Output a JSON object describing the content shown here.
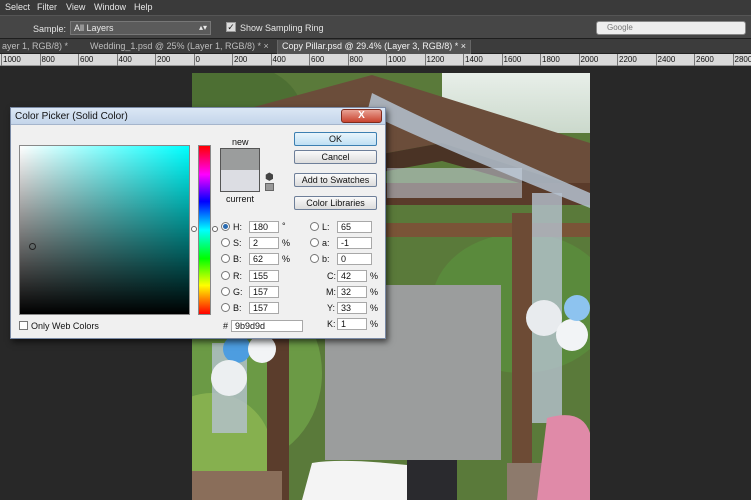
{
  "menu": [
    "Select",
    "Filter",
    "View",
    "Window",
    "Help"
  ],
  "options_bar": {
    "sample_label": "Sample:",
    "sample_value": "All Layers",
    "sampling_ring_label": "Show Sampling Ring",
    "sampling_ring_checked": "✓",
    "search_placeholder": "Google"
  },
  "tabs": [
    {
      "label": "ayer 1, RGB/8) *"
    },
    {
      "label": "Wedding_1.psd @ 25% (Layer 1, RGB/8) * ×"
    },
    {
      "label": "Copy Pillar.psd @ 29.4% (Layer 3, RGB/8) * ×"
    }
  ],
  "ruler": [
    "1000",
    "800",
    "600",
    "400",
    "200",
    "0",
    "200",
    "400",
    "600",
    "800",
    "1000",
    "1200",
    "1400",
    "1600",
    "1800",
    "2000",
    "2200",
    "2400",
    "2600",
    "2800"
  ],
  "dialog": {
    "title": "Color Picker (Solid Color)",
    "close": "X",
    "new_label": "new",
    "current_label": "current",
    "new_color": "#9b9d9d",
    "current_color": "#dcdde3",
    "buttons": {
      "ok": "OK",
      "cancel": "Cancel",
      "add_swatches": "Add to Swatches",
      "libraries": "Color Libraries"
    },
    "hsb": {
      "h_label": "H:",
      "h_value": "180",
      "h_unit": "°",
      "s_label": "S:",
      "s_value": "2",
      "s_unit": "%",
      "b_label": "B:",
      "b_value": "62",
      "b_unit": "%"
    },
    "rgb": {
      "r_label": "R:",
      "r_value": "155",
      "g_label": "G:",
      "g_value": "157",
      "b_label": "B:",
      "b_value": "157"
    },
    "lab": {
      "l_label": "L:",
      "l_value": "65",
      "a_label": "a:",
      "a_value": "-1",
      "b_label": "b:",
      "b_value": "0"
    },
    "cmyk": {
      "c_label": "C:",
      "c_value": "42",
      "m_label": "M:",
      "m_value": "32",
      "y_label": "Y:",
      "y_value": "33",
      "k_label": "K:",
      "k_value": "1",
      "unit": "%"
    },
    "hex_label": "#",
    "hex_value": "9b9d9d",
    "only_web_colors": "Only Web Colors"
  }
}
